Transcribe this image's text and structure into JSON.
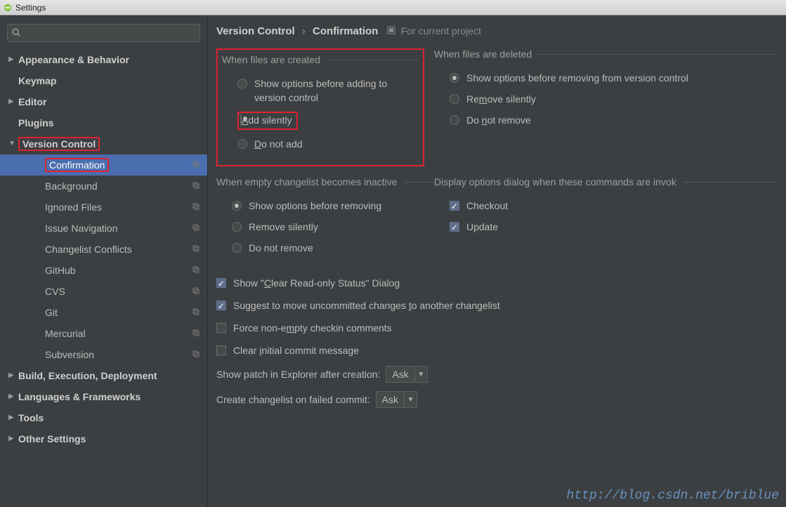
{
  "window": {
    "title": "Settings"
  },
  "search": {
    "placeholder": ""
  },
  "sidebar": {
    "items": [
      {
        "label": "Appearance & Behavior",
        "bold": true,
        "arrow": "▶"
      },
      {
        "label": "Keymap",
        "bold": true,
        "arrow": ""
      },
      {
        "label": "Editor",
        "bold": true,
        "arrow": "▶"
      },
      {
        "label": "Plugins",
        "bold": true,
        "arrow": ""
      },
      {
        "label": "Version Control",
        "bold": true,
        "arrow": "▼",
        "highlight": true
      },
      {
        "label": "Confirmation",
        "indent": 2,
        "selected": true,
        "copy": true,
        "highlight": true
      },
      {
        "label": "Background",
        "indent": 2,
        "copy": true
      },
      {
        "label": "Ignored Files",
        "indent": 2,
        "copy": true
      },
      {
        "label": "Issue Navigation",
        "indent": 2,
        "copy": true
      },
      {
        "label": "Changelist Conflicts",
        "indent": 2,
        "copy": true
      },
      {
        "label": "GitHub",
        "indent": 2,
        "copy": true
      },
      {
        "label": "CVS",
        "indent": 2,
        "copy": true
      },
      {
        "label": "Git",
        "indent": 2,
        "copy": true
      },
      {
        "label": "Mercurial",
        "indent": 2,
        "copy": true
      },
      {
        "label": "Subversion",
        "indent": 2,
        "copy": true
      },
      {
        "label": "Build, Execution, Deployment",
        "bold": true,
        "arrow": "▶"
      },
      {
        "label": "Languages & Frameworks",
        "bold": true,
        "arrow": "▶"
      },
      {
        "label": "Tools",
        "bold": true,
        "arrow": "▶"
      },
      {
        "label": "Other Settings",
        "bold": true,
        "arrow": "▶"
      }
    ]
  },
  "breadcrumb": {
    "root": "Version Control",
    "leaf": "Confirmation",
    "scope": "For current project"
  },
  "groups": {
    "created": {
      "legend": "When files are created",
      "options": [
        {
          "pre": "Show options before adding to version control",
          "sel": false
        },
        {
          "pre": "",
          "mn": "A",
          "post": "dd silently",
          "sel": true,
          "highlight": true
        },
        {
          "pre": "",
          "mn": "D",
          "post": "o not add",
          "sel": false
        }
      ]
    },
    "deleted": {
      "legend": "When files are deleted",
      "options": [
        {
          "pre": "Show options before removing from version control",
          "sel": true
        },
        {
          "pre": "Re",
          "mn": "m",
          "post": "ove silently",
          "sel": false
        },
        {
          "pre": "Do ",
          "mn": "n",
          "post": "ot remove",
          "sel": false
        }
      ]
    },
    "emptycl": {
      "legend": "When empty changelist becomes inactive",
      "options": [
        {
          "pre": "Show options before removing",
          "sel": true
        },
        {
          "pre": "Remove silently",
          "sel": false
        },
        {
          "pre": "Do not remove",
          "sel": false
        }
      ]
    },
    "displaydlg": {
      "legend": "Display options dialog when these commands are invok",
      "options": [
        {
          "pre": "Checkout",
          "sel": true
        },
        {
          "pre": "Update",
          "sel": true
        }
      ]
    }
  },
  "checks": [
    {
      "pre": "Show \"",
      "mn": "C",
      "post": "lear Read-only Status\" Dialog",
      "sel": true
    },
    {
      "pre": "Suggest to move uncommitted changes ",
      "mn": "t",
      "post": "o another changelist",
      "sel": true
    },
    {
      "pre": "Force non-e",
      "mn": "m",
      "post": "pty checkin comments",
      "sel": false
    },
    {
      "pre": "Clear ",
      "mn": "i",
      "post": "nitial commit message",
      "sel": false
    }
  ],
  "dropdowns": {
    "patch": {
      "label": "Show patch in Explorer after creation:",
      "value": "Ask"
    },
    "failed": {
      "label": "Create changelist on failed commit:",
      "value": "Ask"
    }
  },
  "watermark": "http://blog.csdn.net/briblue"
}
